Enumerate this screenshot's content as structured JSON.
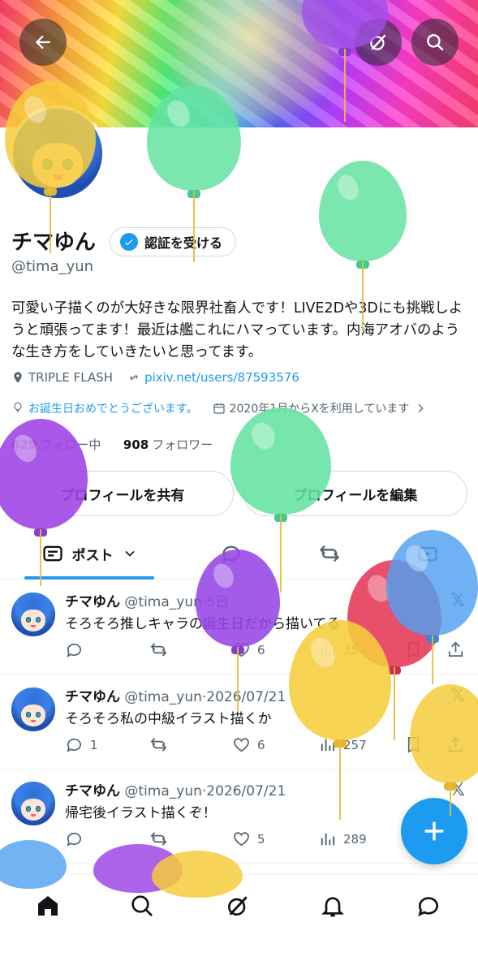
{
  "profile": {
    "name": "チマゆん",
    "verify_label": "認証を受ける",
    "handle": "@tima_yun",
    "bio": "可愛い子描くのが大好きな限界社畜人です！LIVE2Dや3Dにも挑戦しようと頑張ってます！最近は艦これにハマっています。内海アオバのような生き方をしていきたいと思ってます。",
    "location": "TRIPLE FLASH",
    "website": "pixiv.net/users/87593576",
    "birthday": "お誕生日おめでとうございます。",
    "joined": "2020年1月からXを利用しています",
    "following_count": "629",
    "following_label": "フォロー中",
    "followers_count": "908",
    "followers_label": "フォロワー",
    "share_label": "プロフィールを共有",
    "edit_label": "プロフィールを編集"
  },
  "tabs": {
    "posts_label": "ポスト"
  },
  "posts": [
    {
      "name": "チマゆん",
      "handle": "@tima_yun",
      "sep": "·",
      "time": "5日",
      "text": "そろそろ推しキャラの誕生日だから描いてる",
      "replies": "",
      "reposts": "",
      "likes": "6",
      "views": "351"
    },
    {
      "name": "チマゆん",
      "handle": "@tima_yun",
      "sep": "·",
      "time": "2026/07/21",
      "text": "そろそろ私の中級イラスト描くか",
      "replies": "1",
      "reposts": "",
      "likes": "6",
      "views": "257"
    },
    {
      "name": "チマゆん",
      "handle": "@tima_yun",
      "sep": "·",
      "time": "2026/07/21",
      "text": "帰宅後イラスト描くぞ！",
      "replies": "",
      "reposts": "",
      "likes": "5",
      "views": "289"
    }
  ],
  "icons": {
    "top": [
      "back-arrow-icon",
      "grok-icon",
      "search-icon"
    ],
    "nav": [
      "home-icon",
      "search-icon",
      "grok-icon",
      "bell-icon",
      "message-icon"
    ],
    "fab": "plus-icon"
  },
  "colors": {
    "accent": "#1d9bf0",
    "text": "#0f1419",
    "muted": "#536471"
  }
}
